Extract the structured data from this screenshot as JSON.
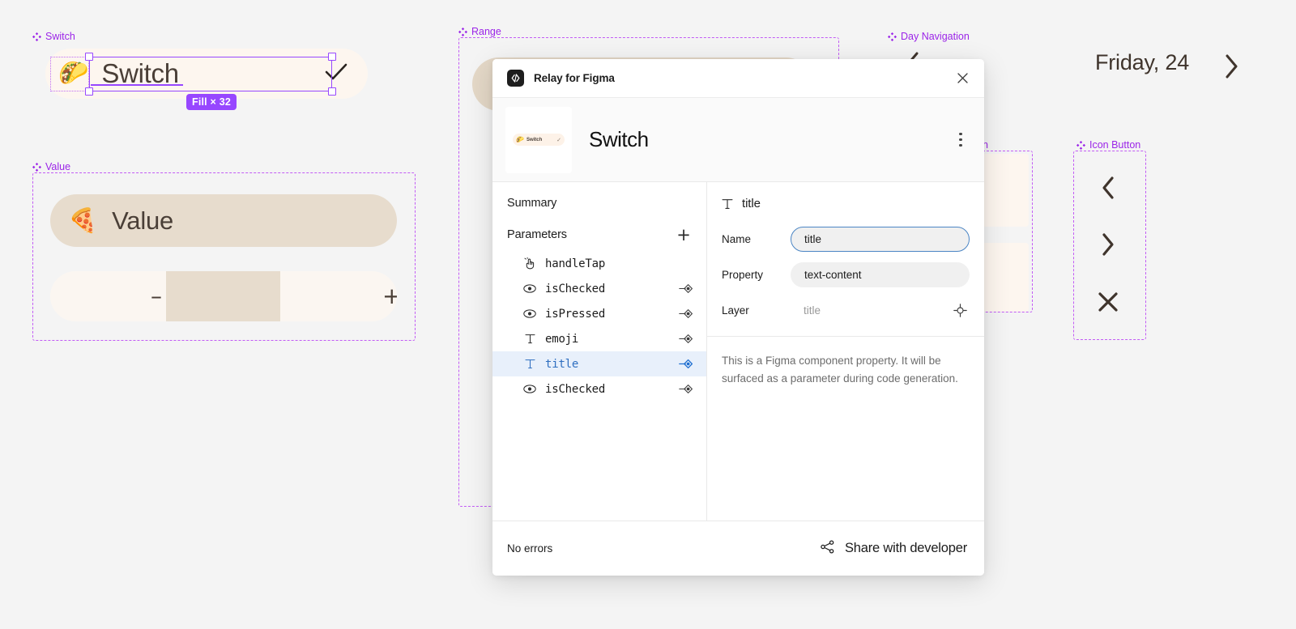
{
  "canvas": {
    "background": "#f4f4f4",
    "accent_purple": "#9747ff",
    "label_purple": "#9b24e8",
    "frames": [
      {
        "key": "switch",
        "label": "Switch"
      },
      {
        "key": "value",
        "label": "Value"
      },
      {
        "key": "range",
        "label": "Range"
      },
      {
        "key": "day_navigation",
        "label": "Day Navigation"
      },
      {
        "key": "occluded",
        "label": "on"
      },
      {
        "key": "icon_button",
        "label": "Icon Button"
      }
    ]
  },
  "switch_component": {
    "emoji": "🌮",
    "title": "Switch",
    "check_icon": "check-icon",
    "selection_badge": "Fill × 32",
    "fill_color": "#fdf6ef",
    "text_color": "#4a3f37"
  },
  "value_component": {
    "emoji": "🍕",
    "title": "Value",
    "pill_color": "#e7dccd",
    "stepper": {
      "decrement_label": "–",
      "increment_label": "+",
      "track_color": "#fbf6f1",
      "fill_color": "#e7dccd"
    }
  },
  "day_navigation": {
    "label": "Friday, 24",
    "prev_icon": "chevron-left-icon",
    "next_icon": "chevron-right-icon"
  },
  "icon_button_frame": {
    "buttons": [
      {
        "name": "chevron-left-icon",
        "glyph": "‹"
      },
      {
        "name": "chevron-right-icon",
        "glyph": "›"
      },
      {
        "name": "close-x-icon",
        "glyph": "✕"
      }
    ]
  },
  "dialog": {
    "titlebar": {
      "logo_icon": "code-brackets-icon",
      "title": "Relay for Figma",
      "close_icon": "close-icon"
    },
    "header": {
      "thumbnail": {
        "emoji": "🌮",
        "text": "Switch",
        "check": "✓"
      },
      "component_name": "Switch",
      "menu_icon": "kebab-menu-icon"
    },
    "left_panel": {
      "summary_label": "Summary",
      "parameters_label": "Parameters",
      "add_icon": "plus-icon",
      "parameters": [
        {
          "name": "handleTap",
          "icon": "tap-gesture-icon",
          "has_link": false,
          "selected": false
        },
        {
          "name": "isChecked",
          "icon": "eye-icon",
          "has_link": true,
          "selected": false
        },
        {
          "name": "isPressed",
          "icon": "eye-icon",
          "has_link": true,
          "selected": false
        },
        {
          "name": "emoji",
          "icon": "text-type-icon",
          "has_link": true,
          "selected": false
        },
        {
          "name": "title",
          "icon": "text-type-icon",
          "has_link": true,
          "selected": true
        },
        {
          "name": "isChecked",
          "icon": "eye-icon",
          "has_link": true,
          "selected": false
        }
      ]
    },
    "right_panel": {
      "header_icon": "text-type-icon",
      "header_name": "title",
      "fields": [
        {
          "label": "Name",
          "value": "title",
          "type": "input",
          "focused": true
        },
        {
          "label": "Property",
          "value": "text-content",
          "type": "input",
          "focused": false
        },
        {
          "label": "Layer",
          "value": "title",
          "type": "static",
          "focused": false
        }
      ],
      "layer_target_icon": "crosshair-icon",
      "description": "This is a Figma component property. It will be surfaced as a parameter during code generation."
    },
    "footer": {
      "status": "No errors",
      "share_icon": "share-icon",
      "share_label": "Share with developer"
    }
  }
}
